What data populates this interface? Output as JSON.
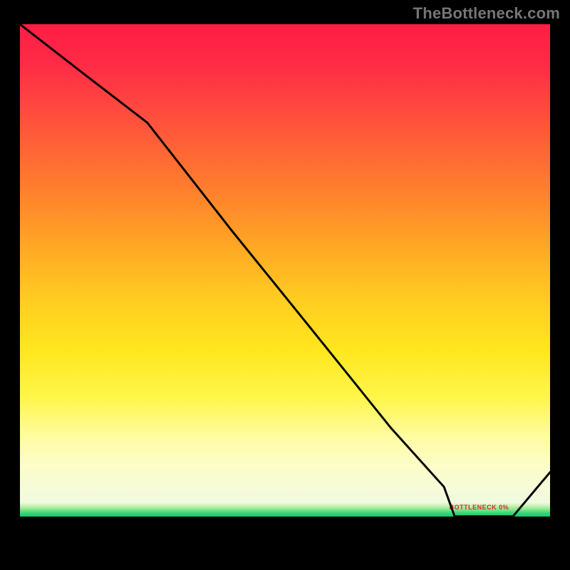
{
  "watermark": "TheBottleneck.com",
  "tiny_label": "BOTTLENECK 0%",
  "colors": {
    "frame": "#000000",
    "curve": "#000000",
    "green_band_bottom": "#14c96d",
    "watermark_text": "#767676",
    "tiny_label_text": "#d22b2b"
  },
  "chart_data": {
    "type": "line",
    "title": "",
    "xlabel": "",
    "ylabel": "",
    "xlim": [
      0,
      100
    ],
    "ylim": [
      0,
      100
    ],
    "notes": "Background is a vertical heat gradient red→yellow→pale with a thin green band near y≈7–9 and black below. Black curve descends from top-left, kinks near x≈24, reaches ~0 around x≈82–93, then rises. y is value height as percent of plot; x is percent across plot.",
    "series": [
      {
        "name": "curve",
        "x": [
          0,
          12,
          24,
          40,
          55,
          70,
          80,
          82,
          88,
          93,
          100
        ],
        "y": [
          100,
          90,
          80,
          58,
          38,
          18,
          6,
          0,
          0,
          0,
          9
        ]
      }
    ],
    "green_band_y_range": [
      6.4,
      9.0
    ]
  }
}
